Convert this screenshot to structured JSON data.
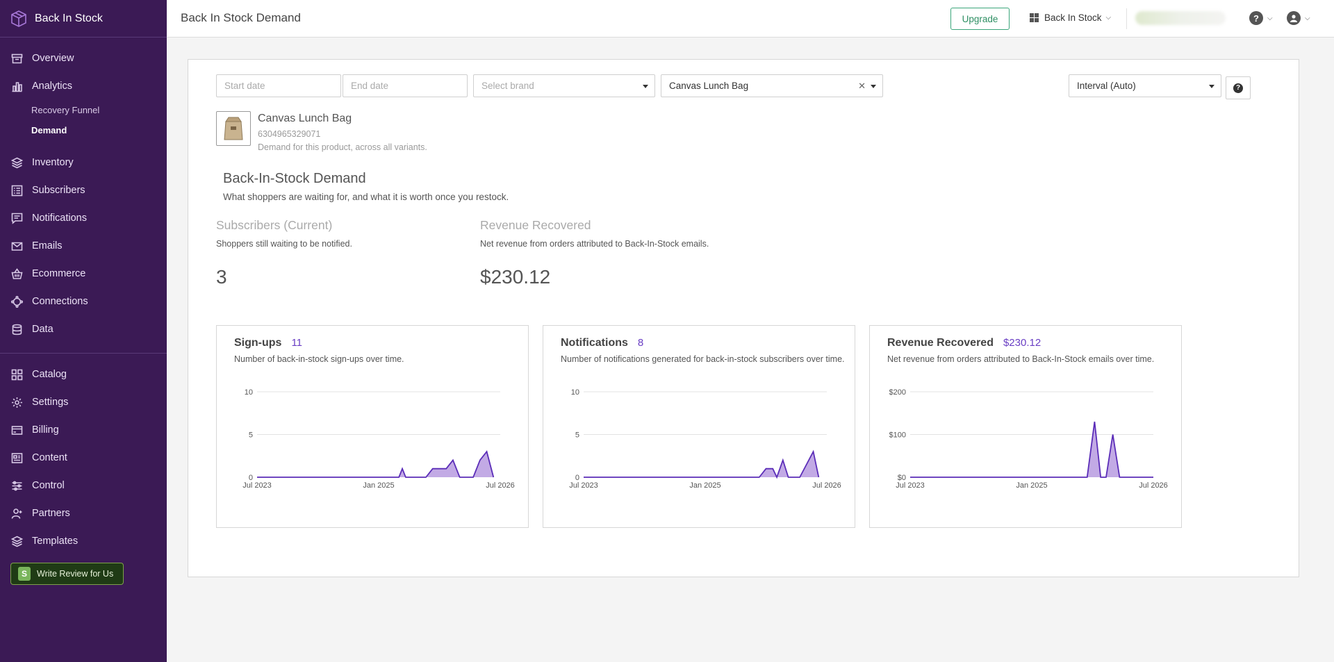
{
  "app": {
    "name": "Back In Stock"
  },
  "sidebar": {
    "items": [
      {
        "label": "Overview"
      },
      {
        "label": "Analytics"
      },
      {
        "label": "Inventory"
      },
      {
        "label": "Subscribers"
      },
      {
        "label": "Notifications"
      },
      {
        "label": "Emails"
      },
      {
        "label": "Ecommerce"
      },
      {
        "label": "Connections"
      },
      {
        "label": "Data"
      },
      {
        "label": "Catalog"
      },
      {
        "label": "Settings"
      },
      {
        "label": "Billing"
      },
      {
        "label": "Content"
      },
      {
        "label": "Control"
      },
      {
        "label": "Partners"
      },
      {
        "label": "Templates"
      }
    ],
    "analytics_sub": [
      {
        "label": "Recovery Funnel"
      },
      {
        "label": "Demand"
      }
    ],
    "review_button": "Write Review for Us"
  },
  "topbar": {
    "title": "Back In Stock Demand",
    "upgrade": "Upgrade",
    "app_switch": "Back In Stock"
  },
  "filters": {
    "start_date_placeholder": "Start date",
    "end_date_placeholder": "End date",
    "brand_placeholder": "Select brand",
    "product_value": "Canvas Lunch Bag",
    "interval_value": "Interval (Auto)"
  },
  "product": {
    "name": "Canvas Lunch Bag",
    "id": "6304965329071",
    "description": "Demand for this product, across all variants."
  },
  "section": {
    "title": "Back-In-Stock Demand",
    "subtitle": "What shoppers are waiting for, and what it is worth once you restock."
  },
  "metrics": [
    {
      "title": "Subscribers (Current)",
      "subtitle": "Shoppers still waiting to be notified.",
      "value": "3"
    },
    {
      "title": "Revenue Recovered",
      "subtitle": "Net revenue from orders attributed to Back-In-Stock emails.",
      "value": "$230.12"
    }
  ],
  "cards": [
    {
      "title": "Sign-ups",
      "count": "11",
      "subtitle": "Number of back-in-stock sign-ups over time."
    },
    {
      "title": "Notifications",
      "count": "8",
      "subtitle": "Number of notifications generated for back-in-stock subscribers over time."
    },
    {
      "title": "Revenue Recovered",
      "count": "$230.12",
      "subtitle": "Net revenue from orders attributed to Back-In-Stock emails over time."
    }
  ],
  "colors": {
    "sidebar": "#3b1a55",
    "accent": "#6a3fc4",
    "area_fill": "#b79be0",
    "line": "#5b2db8"
  },
  "chart_data": [
    {
      "type": "area",
      "title": "Sign-ups",
      "x": [
        "Jul 2023",
        "Jan 2025",
        "Jul 2026"
      ],
      "xlim": [
        0,
        36
      ],
      "ylim": [
        0,
        10
      ],
      "yticks": [
        0,
        5,
        10
      ],
      "ytick_labels": [
        "0",
        "5",
        "10"
      ],
      "series": [
        {
          "points": [
            [
              0,
              0
            ],
            [
              21,
              0
            ],
            [
              21.5,
              1
            ],
            [
              22,
              0
            ],
            [
              25,
              0
            ],
            [
              26,
              1
            ],
            [
              28,
              1
            ],
            [
              29,
              2
            ],
            [
              30,
              0
            ],
            [
              32,
              0
            ],
            [
              33,
              2
            ],
            [
              34,
              3
            ],
            [
              35,
              0
            ]
          ]
        }
      ]
    },
    {
      "type": "area",
      "title": "Notifications",
      "x": [
        "Jul 2023",
        "Jan 2025",
        "Jul 2026"
      ],
      "xlim": [
        0,
        36
      ],
      "ylim": [
        0,
        10
      ],
      "yticks": [
        0,
        5,
        10
      ],
      "ytick_labels": [
        "0",
        "5",
        "10"
      ],
      "series": [
        {
          "points": [
            [
              0,
              0
            ],
            [
              26,
              0
            ],
            [
              27,
              1
            ],
            [
              28,
              1
            ],
            [
              28.6,
              0
            ],
            [
              29.5,
              2
            ],
            [
              30.3,
              0
            ],
            [
              32,
              0
            ],
            [
              34,
              3
            ],
            [
              34.8,
              0
            ]
          ]
        }
      ]
    },
    {
      "type": "area",
      "title": "Revenue Recovered",
      "x": [
        "Jul 2023",
        "Jan 2025",
        "Jul 2026"
      ],
      "xlim": [
        0,
        36
      ],
      "ylim": [
        0,
        200
      ],
      "yticks": [
        0,
        100,
        200
      ],
      "ytick_labels": [
        "$0",
        "$100",
        "$200"
      ],
      "series": [
        {
          "points": [
            [
              0,
              0
            ],
            [
              26.2,
              0
            ],
            [
              27.3,
              130
            ],
            [
              28.2,
              0
            ],
            [
              29,
              0
            ],
            [
              30,
              100
            ],
            [
              31,
              0
            ],
            [
              36,
              0
            ]
          ]
        }
      ]
    }
  ]
}
